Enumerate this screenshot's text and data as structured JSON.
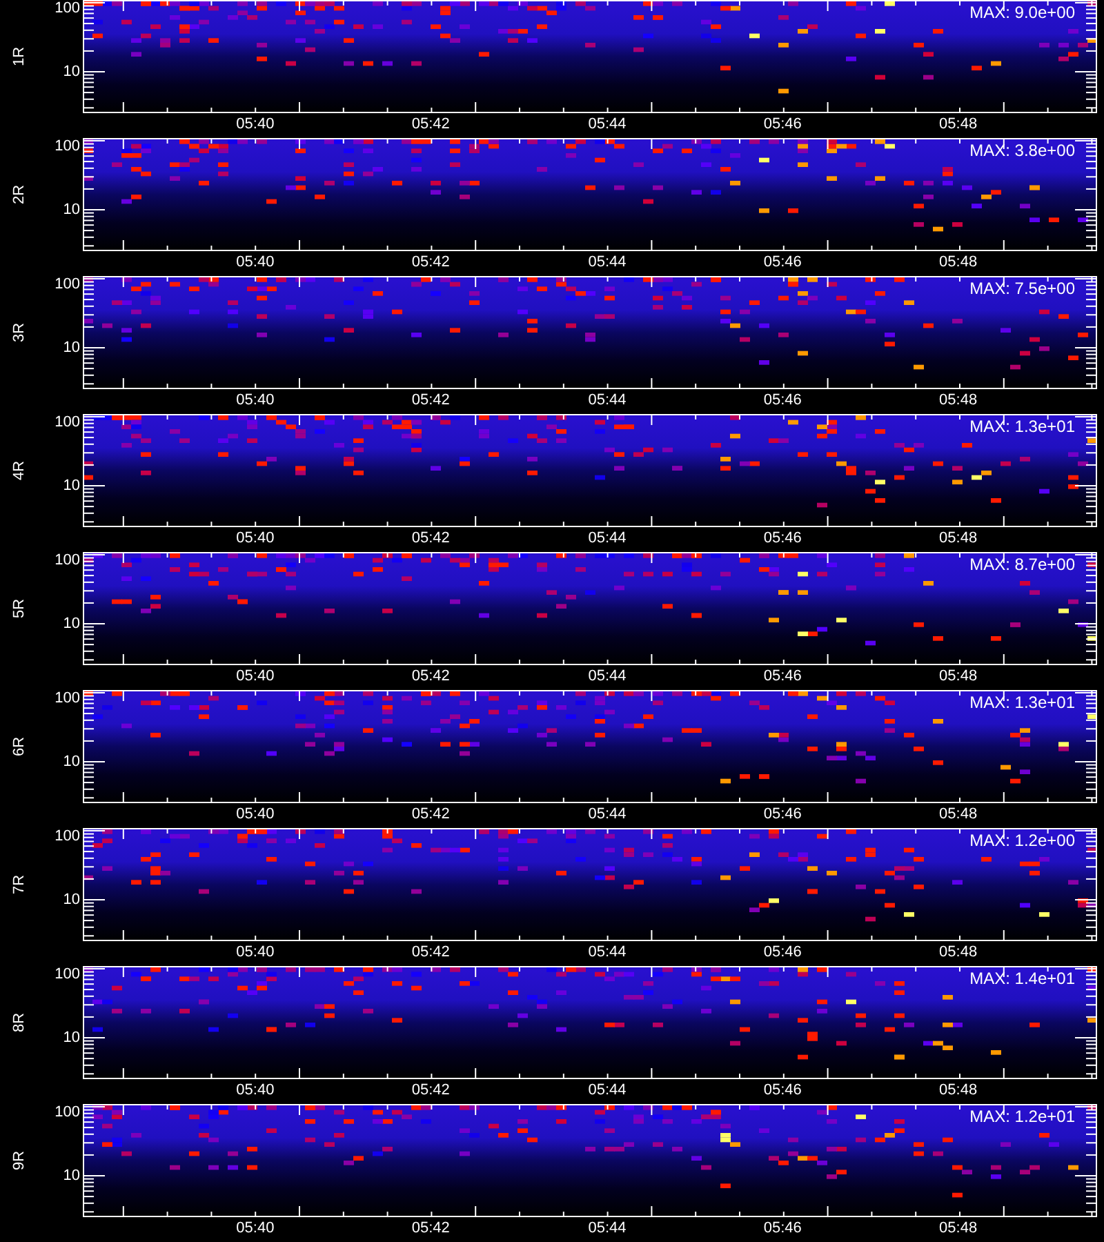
{
  "panels": [
    {
      "label": "1R",
      "max": "MAX: 9.0e+00",
      "yticks": [
        "100",
        "10"
      ],
      "xticks": [
        "05:40",
        "05:42",
        "05:44",
        "05:46",
        "05:48"
      ]
    },
    {
      "label": "2R",
      "max": "MAX: 3.8e+00",
      "yticks": [
        "100",
        "10"
      ],
      "xticks": [
        "05:40",
        "05:42",
        "05:44",
        "05:46",
        "05:48"
      ]
    },
    {
      "label": "3R",
      "max": "MAX: 7.5e+00",
      "yticks": [
        "100",
        "10"
      ],
      "xticks": [
        "05:40",
        "05:42",
        "05:44",
        "05:46",
        "05:48"
      ]
    },
    {
      "label": "4R",
      "max": "MAX: 1.3e+01",
      "yticks": [
        "100",
        "10"
      ],
      "xticks": [
        "05:40",
        "05:42",
        "05:44",
        "05:46",
        "05:48"
      ]
    },
    {
      "label": "5R",
      "max": "MAX: 8.7e+00",
      "yticks": [
        "100",
        "10"
      ],
      "xticks": [
        "05:40",
        "05:42",
        "05:44",
        "05:46",
        "05:48"
      ]
    },
    {
      "label": "6R",
      "max": "MAX: 1.3e+01",
      "yticks": [
        "100",
        "10"
      ],
      "xticks": [
        "05:40",
        "05:42",
        "05:44",
        "05:46",
        "05:48"
      ]
    },
    {
      "label": "7R",
      "max": "MAX: 1.2e+00",
      "yticks": [
        "100",
        "10"
      ],
      "xticks": [
        "05:40",
        "05:42",
        "05:44",
        "05:46",
        "05:48"
      ]
    },
    {
      "label": "8R",
      "max": "MAX: 1.4e+01",
      "yticks": [
        "100",
        "10"
      ],
      "xticks": [
        "05:40",
        "05:42",
        "05:44",
        "05:46",
        "05:48"
      ]
    },
    {
      "label": "9R",
      "max": "MAX: 1.2e+01",
      "yticks": [
        "100",
        "10"
      ],
      "xticks": [
        "05:40",
        "05:42",
        "05:44",
        "05:46",
        "05:48"
      ]
    }
  ]
}
